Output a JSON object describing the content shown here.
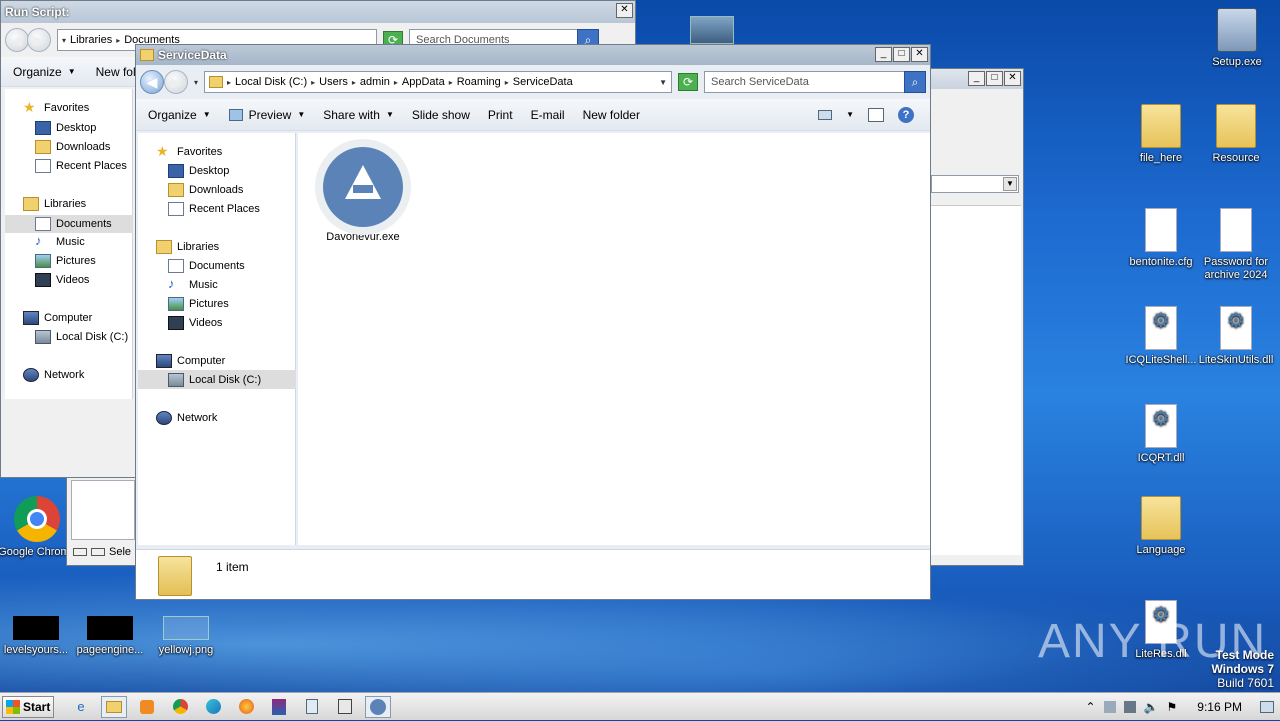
{
  "desktop": {
    "icons": [
      {
        "label": "Setup.exe"
      },
      {
        "label": "file_here"
      },
      {
        "label": "Resource"
      },
      {
        "label": "bentonite.cfg"
      },
      {
        "label": "Password for archive 2024"
      },
      {
        "label": "ICQLiteShell..."
      },
      {
        "label": "LiteSkinUtils.dll"
      },
      {
        "label": "ICQRT.dll"
      },
      {
        "label": "Language"
      },
      {
        "label": "LiteRes.dll"
      },
      {
        "label": "Google Chrome"
      },
      {
        "label": "levelsyours..."
      },
      {
        "label": "pageengine..."
      },
      {
        "label": "yellowj.png"
      }
    ],
    "watermark": "ANY RUN",
    "os_notice": {
      "line1": "Test Mode",
      "line2": "Windows 7",
      "line3": "Build 7601"
    }
  },
  "back_window": {
    "title": "Run Script:",
    "crumbs": [
      "Libraries",
      "Documents"
    ],
    "search_placeholder": "Search Documents",
    "toolbar": {
      "organize": "Organize",
      "new_folder": "New fol"
    },
    "nav": {
      "favorites": "Favorites",
      "desktop": "Desktop",
      "downloads": "Downloads",
      "recent": "Recent Places",
      "libraries": "Libraries",
      "documents": "Documents",
      "music": "Music",
      "pictures": "Pictures",
      "videos": "Videos",
      "computer": "Computer",
      "local_disk": "Local Disk (C:)",
      "network": "Network"
    },
    "bottom_text": "Sele"
  },
  "main_window": {
    "title": "ServiceData",
    "crumbs": [
      "Local Disk (C:)",
      "Users",
      "admin",
      "AppData",
      "Roaming",
      "ServiceData"
    ],
    "search_placeholder": "Search ServiceData",
    "toolbar": {
      "organize": "Organize",
      "preview": "Preview",
      "share_with": "Share with",
      "slide_show": "Slide show",
      "print": "Print",
      "email": "E-mail",
      "new_folder": "New folder"
    },
    "nav": {
      "favorites": "Favorites",
      "desktop": "Desktop",
      "downloads": "Downloads",
      "recent": "Recent Places",
      "libraries": "Libraries",
      "documents": "Documents",
      "music": "Music",
      "pictures": "Pictures",
      "videos": "Videos",
      "computer": "Computer",
      "local_disk": "Local Disk (C:)",
      "network": "Network"
    },
    "files": [
      {
        "name": "Davonevur.exe"
      }
    ],
    "status": "1 item"
  },
  "taskbar": {
    "start": "Start",
    "time": "9:16 PM"
  }
}
